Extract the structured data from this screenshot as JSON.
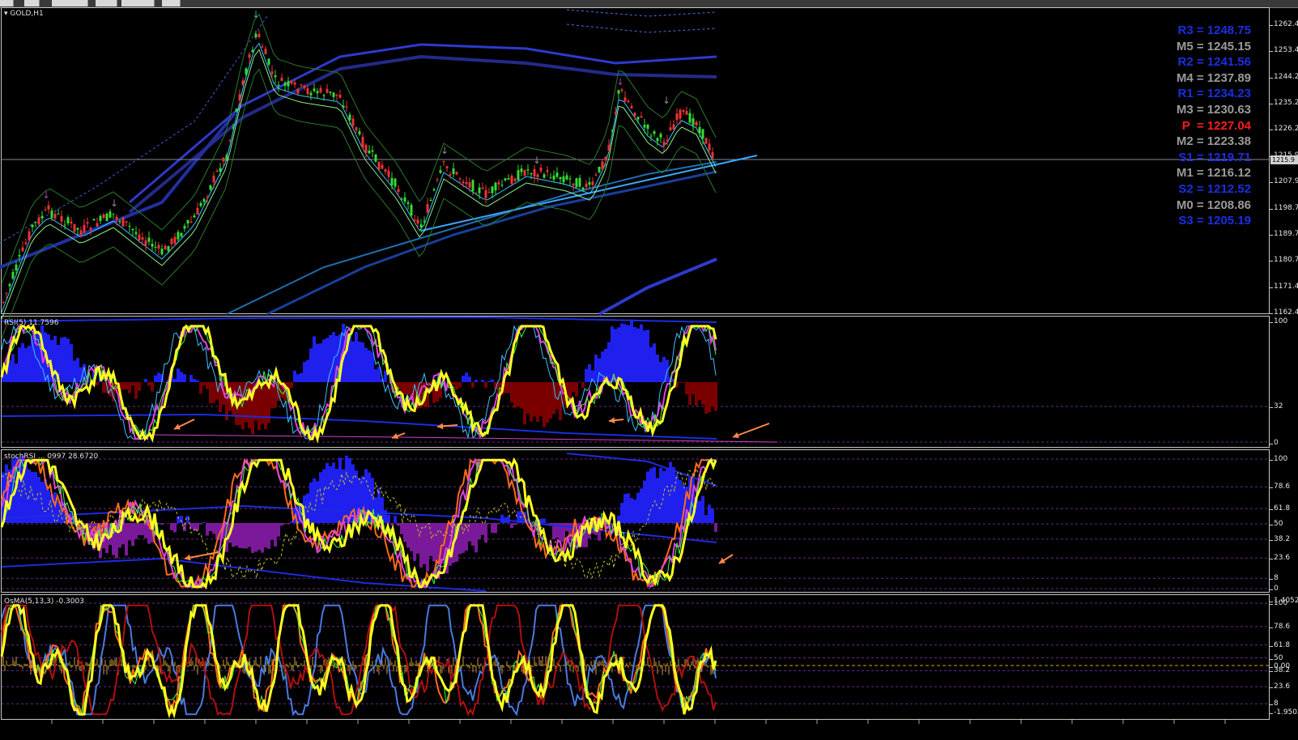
{
  "window": {
    "symbol_label": "GOLD,H1"
  },
  "colors": {
    "background": "#000000",
    "resistance": "#1a2fe0",
    "midpoint": "#9a9a9a",
    "pivot": "#ff1a1a",
    "bull_candle": "#33dd33",
    "bear_candle": "#ee3333",
    "rsi_line": "#ffff22",
    "histogram_up": "#2020ee",
    "histogram_down_rsi": "#7a0000",
    "histogram_down_stoch": "#7a1a9a",
    "arrow": "#ff8a4a"
  },
  "main": {
    "price_axis": [
      "1262.4",
      "1253.4",
      "1244.2",
      "1235.2",
      "1226.2",
      "1215.9",
      "1207.9",
      "1198.7",
      "1189.7",
      "1180.7",
      "1171.4",
      "1162.4"
    ],
    "current_price_tag": "1215.9",
    "pivots": [
      {
        "label": "R3 = 1248.75",
        "kind": "resistance"
      },
      {
        "label": "M5 = 1245.15",
        "kind": "mid"
      },
      {
        "label": "R2 = 1241.56",
        "kind": "resistance"
      },
      {
        "label": "M4 = 1237.89",
        "kind": "mid"
      },
      {
        "label": "R1 = 1234.23",
        "kind": "resistance"
      },
      {
        "label": "M3 = 1230.63",
        "kind": "mid"
      },
      {
        "label": "P  = 1227.04",
        "kind": "pivot"
      },
      {
        "label": "M2 = 1223.38",
        "kind": "mid"
      },
      {
        "label": "S1 = 1219.71",
        "kind": "resistance"
      },
      {
        "label": "M1 = 1216.12",
        "kind": "mid"
      },
      {
        "label": "S2 = 1212.52",
        "kind": "resistance"
      },
      {
        "label": "M0 = 1208.86",
        "kind": "mid"
      },
      {
        "label": "S3 = 1205.19",
        "kind": "resistance"
      }
    ]
  },
  "rsi_pane": {
    "label": "RSI(5) 11.7596",
    "axis": [
      "100",
      "32",
      "0"
    ]
  },
  "stoch_pane": {
    "label": "stochRSI ... 0997 28.6720",
    "axis": [
      "100",
      "78.6",
      "61.8",
      "50",
      "38.2",
      "23.6",
      "8",
      "0"
    ]
  },
  "osma_pane": {
    "label": "OsMA(5,13,3) -0.3003",
    "axis": [
      "100",
      "78.6",
      "61.8",
      "50",
      "38.2",
      "23.6",
      "8"
    ],
    "axis_extra": [
      "0.00",
      "1.4052",
      "-1.9502"
    ]
  }
}
